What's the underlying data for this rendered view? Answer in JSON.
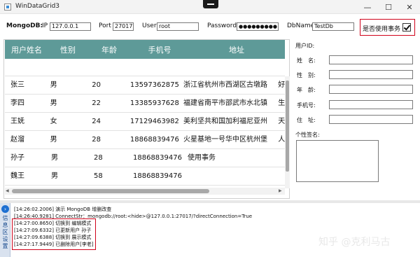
{
  "window": {
    "title": "WinDataGrid3",
    "minimize_glyph": "—",
    "maximize_glyph": "☐",
    "close_glyph": "✕"
  },
  "connection": {
    "mongo_label": "MongoDB:",
    "ip_label": "IP",
    "ip_value": "127.0.0.1",
    "port_label": "Port",
    "port_value": "27017",
    "user_label": "User",
    "user_value": "root",
    "password_label": "Password",
    "password_value": "●●●●●●●●●",
    "dbname_label": "DbName",
    "dbname_value": "TestDb",
    "transaction_label": "是否使用事务",
    "transaction_checked": true
  },
  "grid": {
    "columns": [
      "用户姓名",
      "性别",
      "年龄",
      "手机号",
      "地址"
    ],
    "rows": [
      {
        "name": "张三",
        "gender": "男",
        "age": "20",
        "phone": "13597362875",
        "address": "浙江省杭州市西湖区古墩路",
        "extra": "好"
      },
      {
        "name": "李四",
        "gender": "男",
        "age": "22",
        "phone": "13385937628",
        "address": "福建省南平市邵武市水北镇",
        "extra": "生"
      },
      {
        "name": "王妩",
        "gender": "女",
        "age": "24",
        "phone": "17129463982",
        "address": "美利坚共和国加利福尼亚州",
        "extra": "天"
      },
      {
        "name": "赵溜",
        "gender": "男",
        "age": "28",
        "phone": "18868839476",
        "address": "火星基地一号华中区杭州堡",
        "extra": "人"
      },
      {
        "name": "孙子",
        "gender": "男",
        "age": "28",
        "phone": "18868839476",
        "address": "使用事务",
        "extra": ""
      },
      {
        "name": "魏王",
        "gender": "男",
        "age": "58",
        "phone": "18868839476",
        "address": "",
        "extra": ""
      }
    ]
  },
  "detail": {
    "id_label": "用户ID:",
    "name_label": "姓　名:",
    "gender_label": "性　别:",
    "age_label": "年　龄:",
    "phone_label": "手机号:",
    "address_label": "住　址:",
    "signature_label": "个性签名:"
  },
  "log": {
    "tab_label": "信息区设置",
    "lines": [
      "[14:26:02.2006] 演示 MongoDB 增删改查",
      "[14:26:40.9281] ConnectStr：mongodb://root:<hide>@127.0.0.1:27017/?directConnection=True",
      "[14:27:00.8650] 切换到 编辑模式",
      "[14:27:09.6332] 已更新用户 孙子",
      "[14:27:09.6388] 切换到 展示模式",
      "[14:27:17.9449] 已删除用户[李老]"
    ]
  },
  "watermark": "知乎 @克利马古",
  "colors": {
    "header_bg": "#5e9a98",
    "highlight_border": "#d0021b",
    "tab_icon": "#1d6fd1"
  }
}
